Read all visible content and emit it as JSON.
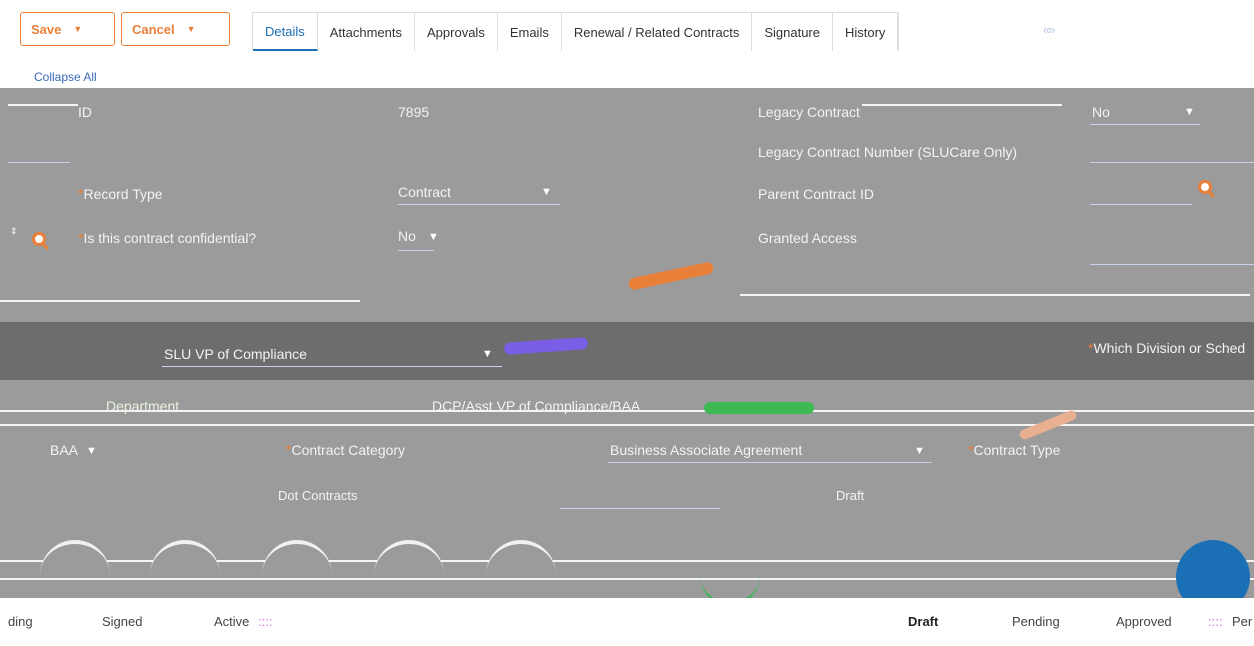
{
  "toolbar": {
    "save_label": "Save",
    "cancel_label": "Cancel"
  },
  "tabs": [
    {
      "label": "Details",
      "active": true
    },
    {
      "label": "Attachments"
    },
    {
      "label": "Approvals"
    },
    {
      "label": "Emails"
    },
    {
      "label": "Renewal / Related Contracts"
    },
    {
      "label": "Signature"
    },
    {
      "label": "History"
    }
  ],
  "tabs_more": "«»",
  "collapse_all": "Collapse All",
  "fields": {
    "id_label": "ID",
    "id_value": "7895",
    "legacy_contract_label": "Legacy Contract",
    "legacy_contract_value": "No",
    "legacy_contract_number_label": "Legacy Contract Number (SLUCare Only)",
    "record_type_label": "Record Type",
    "record_type_value": "Contract",
    "parent_contract_label": "Parent Contract ID",
    "confidential_label": "Is this contract confidential?",
    "confidential_value": "No",
    "granted_access_label": "Granted Access",
    "svp_value": "SLU VP of Compliance",
    "which_division_label": "Which Division or Sched",
    "department_label": "Department",
    "department_value": "DCP/Asst VP of Compliance/BAA",
    "baa_value": "BAA",
    "contract_category_label": "Contract Category",
    "contract_category_value": "Business Associate Agreement",
    "contract_type_label": "Contract Type",
    "dotconn_label": "Dot Contracts",
    "draft_value": "Draft"
  },
  "statuses_left": [
    "ding",
    "Signed",
    "Active"
  ],
  "statuses_right": [
    {
      "label": "Draft",
      "bold": true
    },
    {
      "label": "Pending"
    },
    {
      "label": "Approved"
    },
    {
      "label": "Per"
    }
  ],
  "status_dots": "::::",
  "colors": {
    "accent": "#e8803a",
    "tab_active": "#1b6fb5",
    "band": "#9b9b9b",
    "arrow_orange": "#e8803a",
    "arrow_purple": "#7a5fe6",
    "arrow_green": "#3cba54"
  }
}
